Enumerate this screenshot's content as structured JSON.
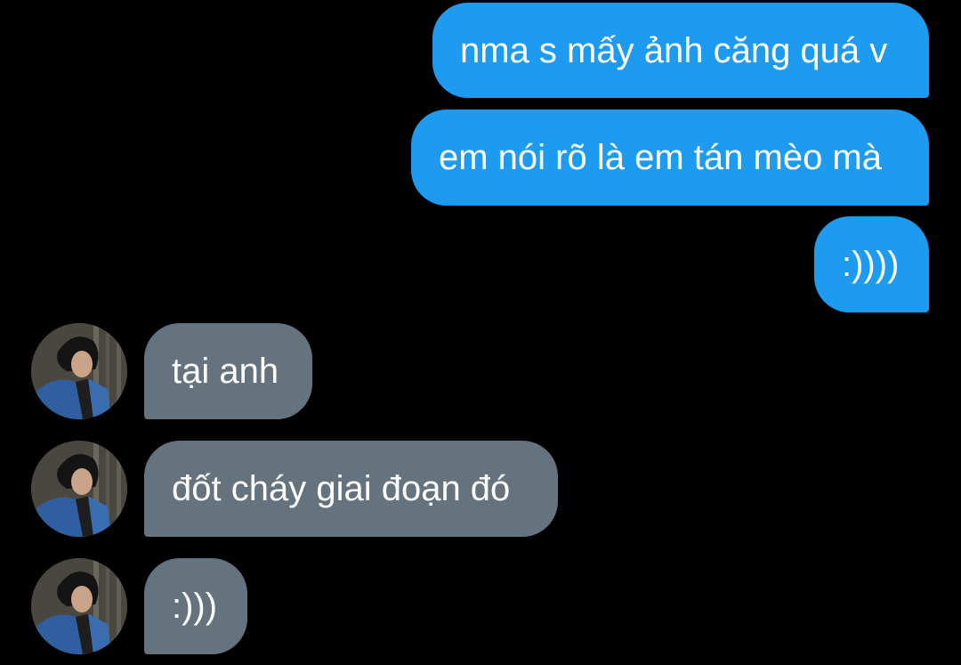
{
  "conversation": {
    "outgoing": [
      {
        "text": "nma s mấy ảnh căng quá v"
      },
      {
        "text": "em nói rõ là em tán mèo mà"
      },
      {
        "text": ":))))"
      }
    ],
    "incoming": [
      {
        "text": "tại anh"
      },
      {
        "text": "đốt cháy giai đoạn đó"
      },
      {
        "text": ":)))"
      }
    ]
  },
  "colors": {
    "background": "#000000",
    "outgoing_bubble": "#1d9bf0",
    "incoming_bubble": "#65737f",
    "text": "#ffffff"
  }
}
